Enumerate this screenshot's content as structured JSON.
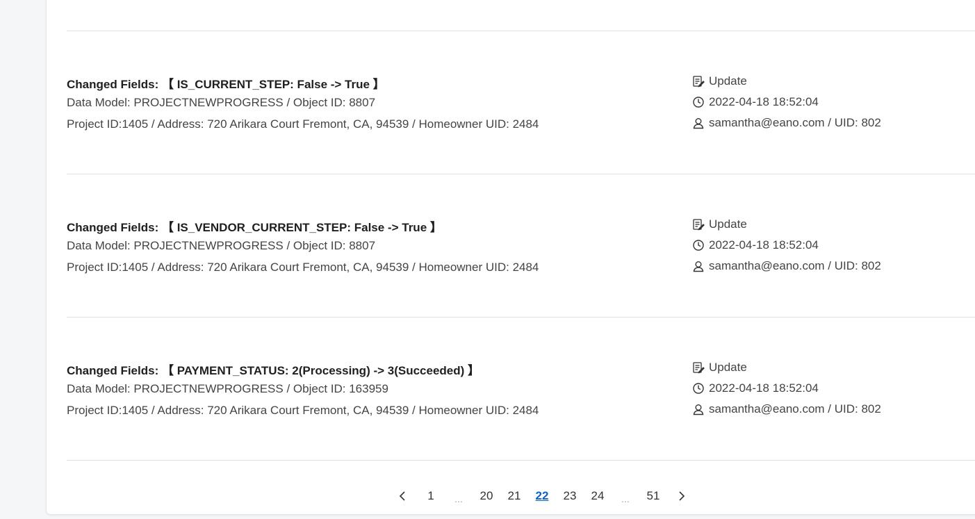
{
  "entries": [
    {
      "changed_label": "Changed Fields:",
      "changed_value": "【 IS_CURRENT_STEP: False -> True 】",
      "model_line": "Data Model: PROJECTNEWPROGRESS / Object ID: 8807",
      "project_line": "Project ID:1405 / Address: 720 Arikara Court Fremont, CA, 94539 / Homeowner UID: 2484",
      "action": "Update",
      "timestamp": "2022-04-18 18:52:04",
      "user": "samantha@eano.com / UID: 802"
    },
    {
      "changed_label": "Changed Fields:",
      "changed_value": "【 IS_VENDOR_CURRENT_STEP: False -> True 】",
      "model_line": "Data Model: PROJECTNEWPROGRESS / Object ID: 8807",
      "project_line": "Project ID:1405 / Address: 720 Arikara Court Fremont, CA, 94539 / Homeowner UID: 2484",
      "action": "Update",
      "timestamp": "2022-04-18 18:52:04",
      "user": "samantha@eano.com / UID: 802"
    },
    {
      "changed_label": "Changed Fields:",
      "changed_value": "【 PAYMENT_STATUS: 2(Processing) -> 3(Succeeded) 】",
      "model_line": "Data Model: PROJECTNEWPROGRESS / Object ID: 163959",
      "project_line": "Project ID:1405 / Address: 720 Arikara Court Fremont, CA, 94539 / Homeowner UID: 2484",
      "action": "Update",
      "timestamp": "2022-04-18 18:52:04",
      "user": "samantha@eano.com / UID: 802"
    }
  ],
  "icons": {
    "action": "edit-document-icon",
    "time": "clock-icon",
    "user": "user-icon"
  },
  "pagination": {
    "prev_icon": "chevron-left-icon",
    "next_icon": "chevron-right-icon",
    "pages": [
      "1",
      "...",
      "20",
      "21",
      "22",
      "23",
      "24",
      "...",
      "51"
    ],
    "current": "22"
  },
  "colors": {
    "active_page": "#0f62c8"
  }
}
